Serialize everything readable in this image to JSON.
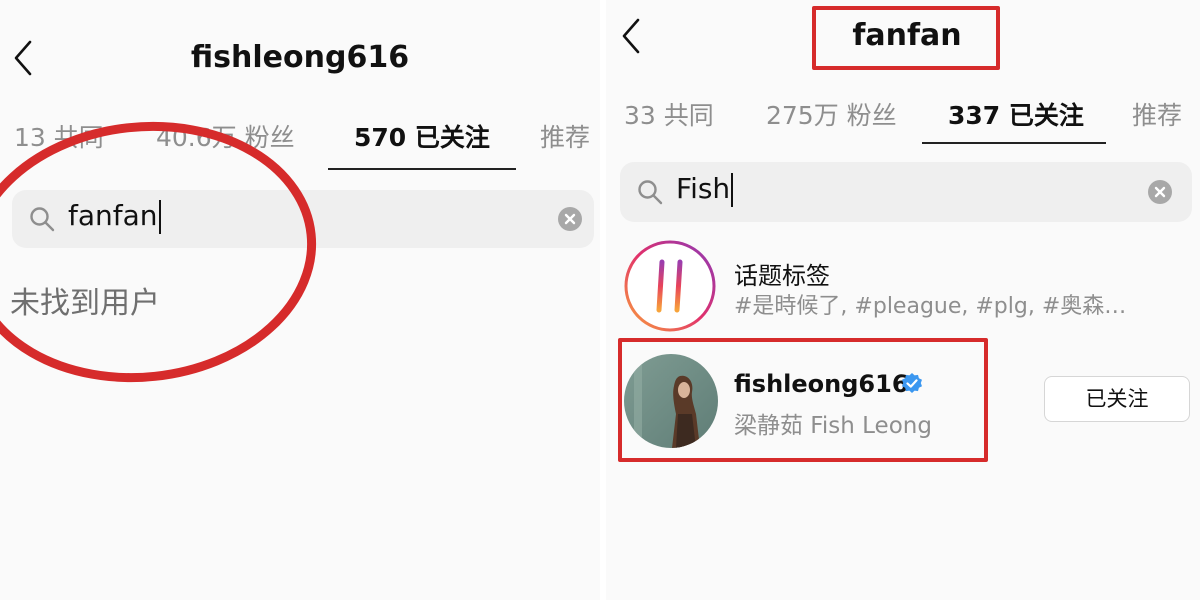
{
  "left": {
    "title": "fishleong616",
    "tabs": [
      {
        "label": "13 共同"
      },
      {
        "label": "40.6万 粉丝"
      },
      {
        "label": "570 已关注",
        "active": true
      },
      {
        "label": "推荐"
      }
    ],
    "search": {
      "value": "fanfan"
    },
    "empty_message": "未找到用户",
    "icons": [
      "back-chevron-icon",
      "search-icon",
      "clear-icon"
    ],
    "annotation_color": "#d62b2b"
  },
  "right": {
    "title": "fanfan",
    "tabs": [
      {
        "label": "33 共同"
      },
      {
        "label": "275万 粉丝"
      },
      {
        "label": "337 已关注",
        "active": true
      },
      {
        "label": "推荐"
      }
    ],
    "search": {
      "value": "Fish"
    },
    "results": [
      {
        "type": "hashtag",
        "title": "话题标签",
        "subtitle": "#是時候了, #pleague, #plg, #奥森…"
      },
      {
        "type": "user",
        "username": "fishleong616",
        "verified": true,
        "full_name": "梁静茹 Fish Leong",
        "button": "已关注"
      }
    ],
    "icons": [
      "back-chevron-icon",
      "search-icon",
      "clear-icon",
      "hashtag-icon",
      "verified-badge-icon"
    ],
    "annotation_color": "#d62b2b"
  }
}
